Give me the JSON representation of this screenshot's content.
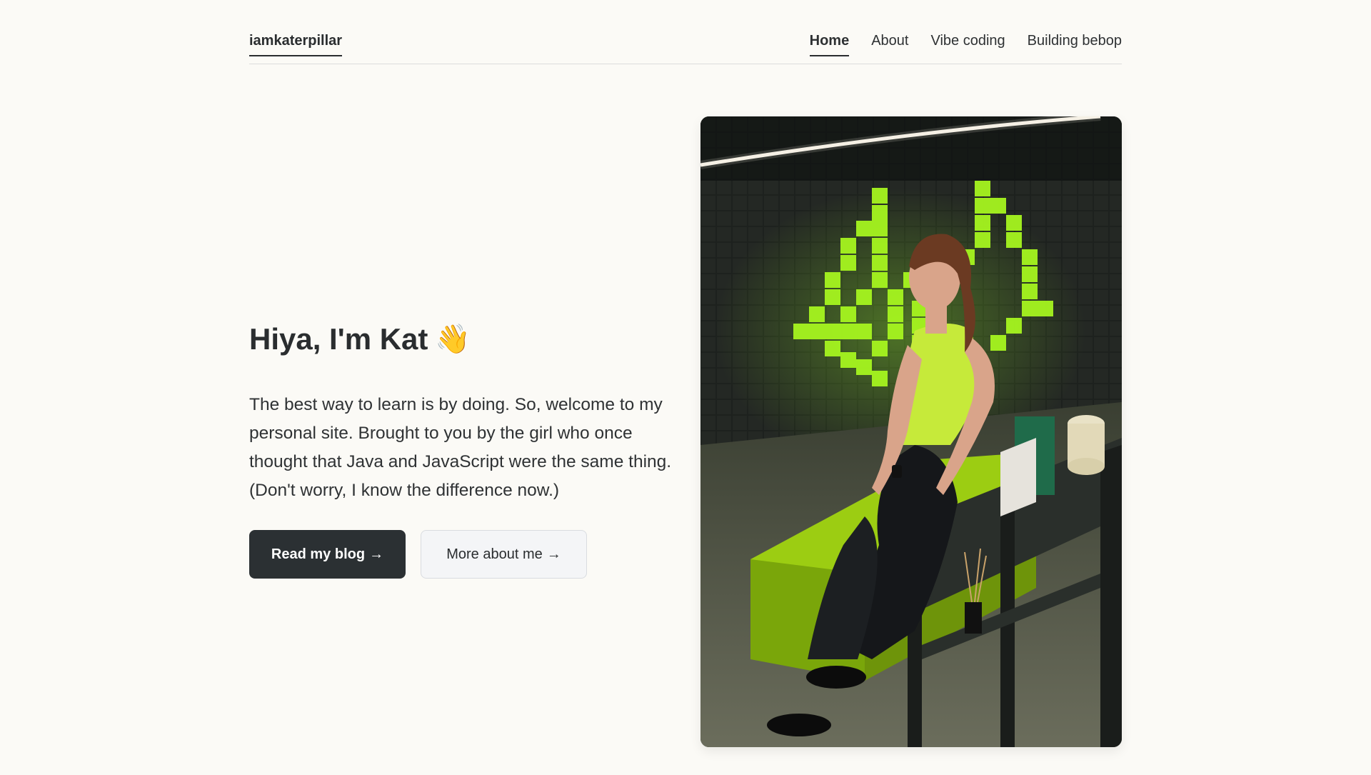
{
  "header": {
    "brand": "iamkaterpillar",
    "nav": [
      {
        "label": "Home",
        "active": true
      },
      {
        "label": "About",
        "active": false
      },
      {
        "label": "Vibe coding",
        "active": false
      },
      {
        "label": "Building bebop",
        "active": false
      }
    ]
  },
  "hero": {
    "title": "Hiya, I'm Kat",
    "wave_icon": "👋",
    "body": "The best way to learn is by doing. So, welcome to my personal site. Brought to you by the girl who once thought that Java and JavaScript were the same thing. (Don't worry, I know the difference now.)",
    "primary_button": "Read my blog",
    "secondary_button": "More about me",
    "arrow_icon": "→"
  },
  "colors": {
    "background": "#fbfaf6",
    "text": "#2a2d2f",
    "primary_button_bg": "#2b3033",
    "secondary_button_bg": "#f4f5f7",
    "neon_green": "#a6f51f"
  }
}
